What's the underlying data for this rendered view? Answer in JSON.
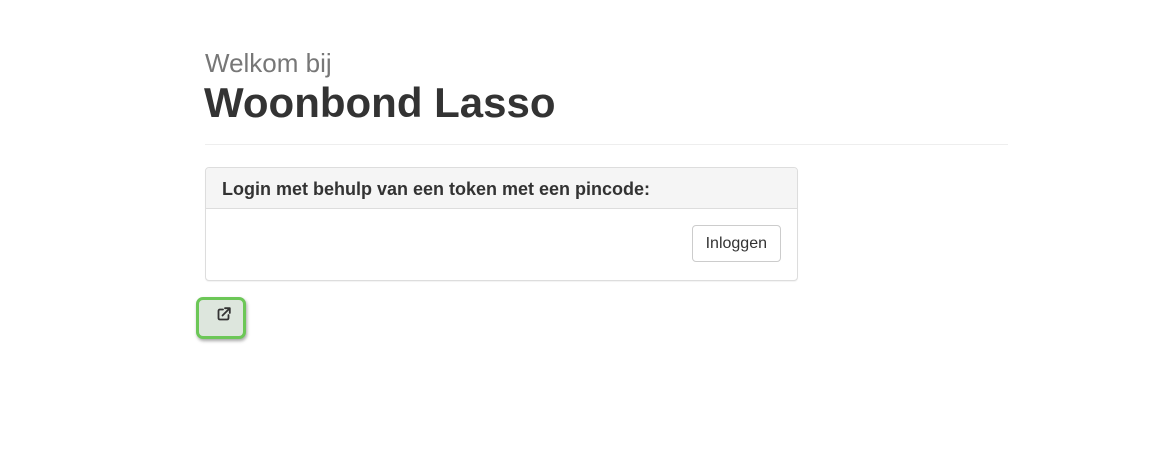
{
  "header": {
    "welcome": "Welkom bij",
    "title": "Woonbond Lasso"
  },
  "login_panel": {
    "heading": "Login met behulp van een token met een pincode:",
    "button_label": "Inloggen"
  },
  "external_button": {
    "icon": "external-link-icon",
    "highlight_color": "#6cc757"
  }
}
